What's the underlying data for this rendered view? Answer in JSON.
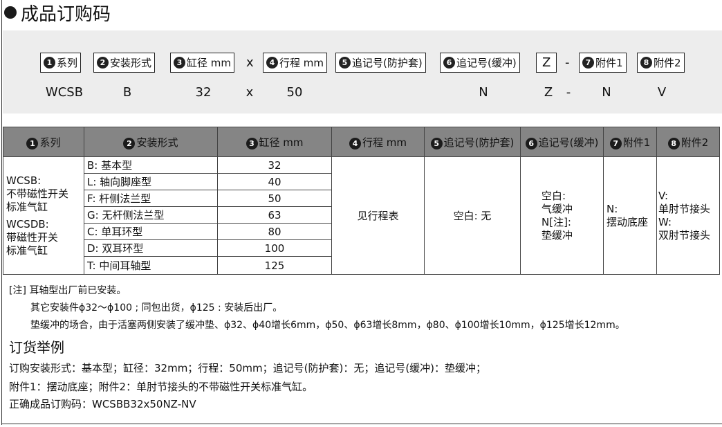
{
  "title": "成品订购码",
  "code_boxes": [
    {
      "num": "1",
      "label": "系列"
    },
    {
      "num": "2",
      "label": "安装形式"
    },
    {
      "num": "3",
      "label": "缸径 mm"
    },
    {
      "num": "4",
      "label": "行程 mm"
    },
    {
      "num": "5",
      "label": "追记号(防护套)"
    },
    {
      "num": "6",
      "label": "追记号(缓冲)"
    },
    {
      "num": "7",
      "label": "附件1"
    },
    {
      "num": "8",
      "label": "附件2"
    }
  ],
  "code_symbols": {
    "x": "x",
    "z": "Z",
    "dash": "-"
  },
  "code_values": [
    "WCSB",
    "B",
    "32",
    "x",
    "50",
    "N",
    "Z",
    "-",
    "N",
    "V"
  ],
  "table": {
    "headers": [
      {
        "num": "1",
        "label": "系列"
      },
      {
        "num": "2",
        "label": "安装形式"
      },
      {
        "num": "3",
        "label": "缸径 mm"
      },
      {
        "num": "4",
        "label": "行程 mm"
      },
      {
        "num": "5",
        "label": "追记号(防护套)"
      },
      {
        "num": "6",
        "label": "追记号(缓冲)"
      },
      {
        "num": "7",
        "label": "附件1"
      },
      {
        "num": "8",
        "label": "附件2"
      }
    ],
    "series": [
      "WCSB:",
      "不带磁性开关",
      "标准气缸",
      "WCSDB:",
      "带磁性开关",
      "标准气缸"
    ],
    "mounts": [
      "B:  基本型",
      "L:  轴向脚座型",
      "F:  杆侧法兰型",
      "G:  无杆侧法兰型",
      "C:  单耳环型",
      "D:  双耳环型",
      "T:  中间耳轴型"
    ],
    "bores": [
      "32",
      "40",
      "50",
      "63",
      "80",
      "100",
      "125"
    ],
    "stroke": "见行程表",
    "boot": "空白:  无",
    "cushion": [
      "空白:",
      "气缓冲",
      "N[注]:",
      "垫缓冲"
    ],
    "acc1": [
      "N:",
      "摆动底座"
    ],
    "acc2": [
      "V:",
      "单肘节接头",
      "W:",
      "双肘节接头"
    ]
  },
  "notes": [
    "[注] 耳轴型出厂前已安装。",
    "其它安装件ϕ32～ϕ100 ; 同包出货，ϕ125 : 安装后出厂。",
    "垫缓冲的场合，由于活塞两侧安装了缓冲垫、ϕ32、ϕ40增长6mm，ϕ50、ϕ63增长8mm，ϕ80、ϕ100增长10mm，ϕ125增长12mm。"
  ],
  "example": {
    "title": "订货举例",
    "lines": [
      "订购安装形式：基本型；缸径：32mm；行程：50mm；追记号(防护套)：无；追记号(缓冲)：垫缓冲；",
      "附件1：摆动底座；附件2：单肘节接头的不带磁性开关标准气缸。",
      "正确成品订购码：WCSBB32x50NZ-NV"
    ]
  }
}
